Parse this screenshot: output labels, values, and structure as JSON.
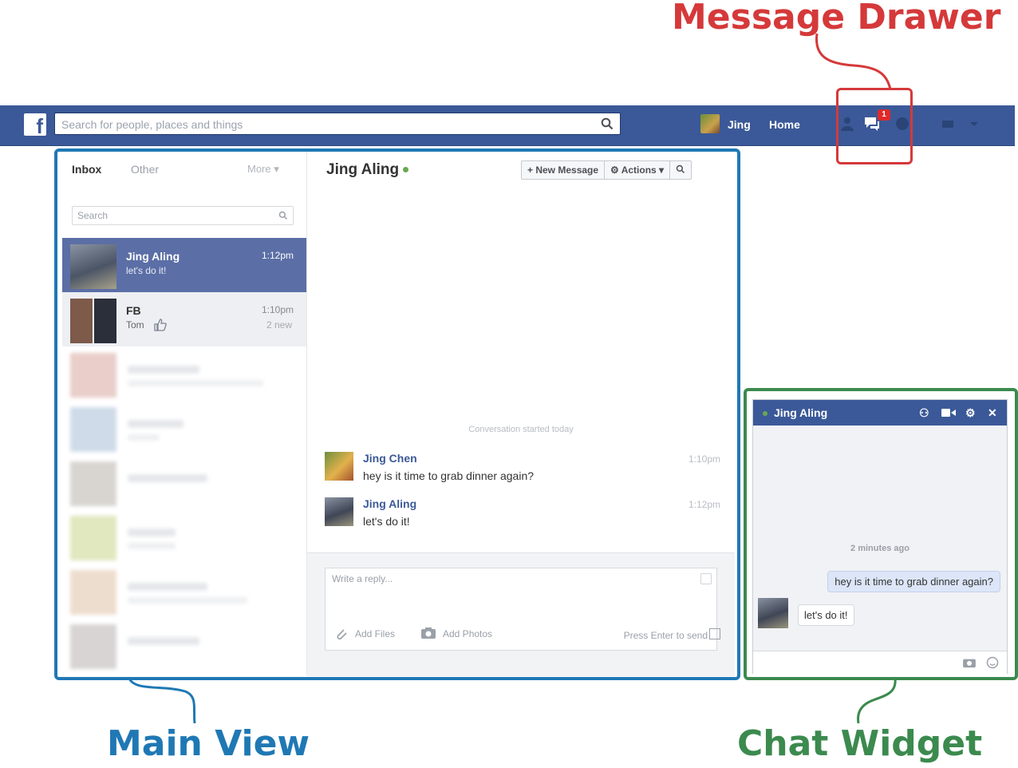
{
  "annotations": {
    "message_drawer": "Message Drawer",
    "main_view": "Main View",
    "chat_widget": "Chat Widget"
  },
  "topbar": {
    "search_placeholder": "Search for people, places and things",
    "user_name": "Jing",
    "home_label": "Home",
    "messages_badge": "1",
    "colors": {
      "brand": "#3b5998",
      "badge": "#e02a2a"
    }
  },
  "inbox": {
    "tabs": {
      "inbox": "Inbox",
      "other": "Other",
      "more": "More ▾"
    },
    "search_placeholder": "Search",
    "threads": [
      {
        "name": "Jing Aling",
        "snippet": "let's do it!",
        "time": "1:12pm",
        "active": true
      },
      {
        "name": "FB",
        "snippet": "Tom",
        "time": "1:10pm",
        "sub": "2 new"
      }
    ]
  },
  "conversation": {
    "title": "Jing Aling",
    "new_message": "+ New Message",
    "actions": "⚙ Actions ▾",
    "started_label": "Conversation started today",
    "messages": [
      {
        "sender": "Jing Chen",
        "text": "hey is it time to grab dinner again?",
        "time": "1:10pm"
      },
      {
        "sender": "Jing Aling",
        "text": "let's do it!",
        "time": "1:12pm"
      }
    ],
    "reply_placeholder": "Write a reply...",
    "add_files": "Add Files",
    "add_photos": "Add Photos",
    "press_enter": "Press Enter to send"
  },
  "chat_widget": {
    "title": "Jing Aling",
    "time_label": "2 minutes ago",
    "outgoing": "hey is it time to grab dinner again?",
    "incoming": "let's do it!"
  }
}
